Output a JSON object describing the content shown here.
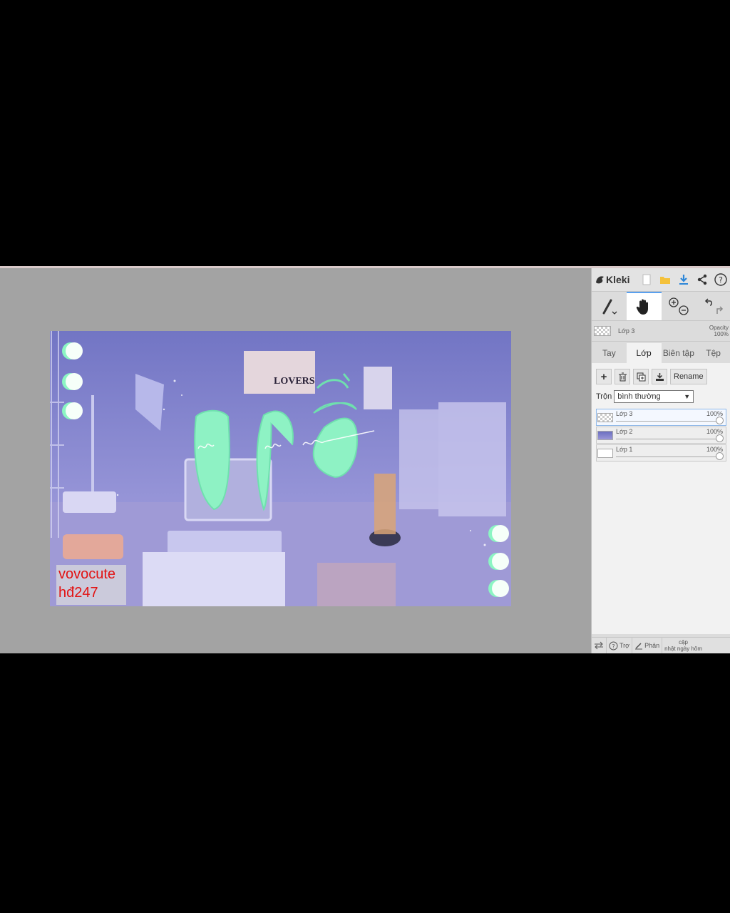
{
  "app": {
    "name": "Kleki",
    "accent_color": "#59a0ef",
    "brand_icon": "kleki-bird-icon"
  },
  "topbar_icons": [
    "new-file-icon",
    "open-folder-icon",
    "download-icon",
    "share-icon",
    "help-icon"
  ],
  "tools": {
    "brush": "brush-icon",
    "hand": "hand-icon",
    "zoom_in": "zoom-in-icon",
    "zoom_out": "zoom-out-icon",
    "undo": "undo-icon",
    "redo": "redo-icon"
  },
  "current_layer": {
    "name": "Lớp 3",
    "opacity_label": "Opacity",
    "opacity_value": "100%"
  },
  "tabs": [
    {
      "label": "Tay",
      "active": false
    },
    {
      "label": "Lớp",
      "active": true
    },
    {
      "label": "Biên tập",
      "active": false
    },
    {
      "label": "Tệp",
      "active": false
    }
  ],
  "layer_actions": {
    "add": "+",
    "rename_label": "Rename"
  },
  "blend": {
    "label": "Trộn",
    "value": "bình thường"
  },
  "layers": [
    {
      "name": "Lớp 3",
      "opacity": "100%",
      "selected": true
    },
    {
      "name": "Lớp 2",
      "opacity": "100%",
      "selected": false
    },
    {
      "name": "Lớp 1",
      "opacity": "100%",
      "selected": false
    }
  ],
  "bottombar": {
    "help_label": "Trợ",
    "feedback_label": "Phản",
    "update_line1": "cập",
    "update_line2": "nhật ngày hôm"
  },
  "artwork": {
    "poster_text": "LOVERS",
    "watermark_line1": "vovocute",
    "watermark_line2": "hđ247"
  }
}
